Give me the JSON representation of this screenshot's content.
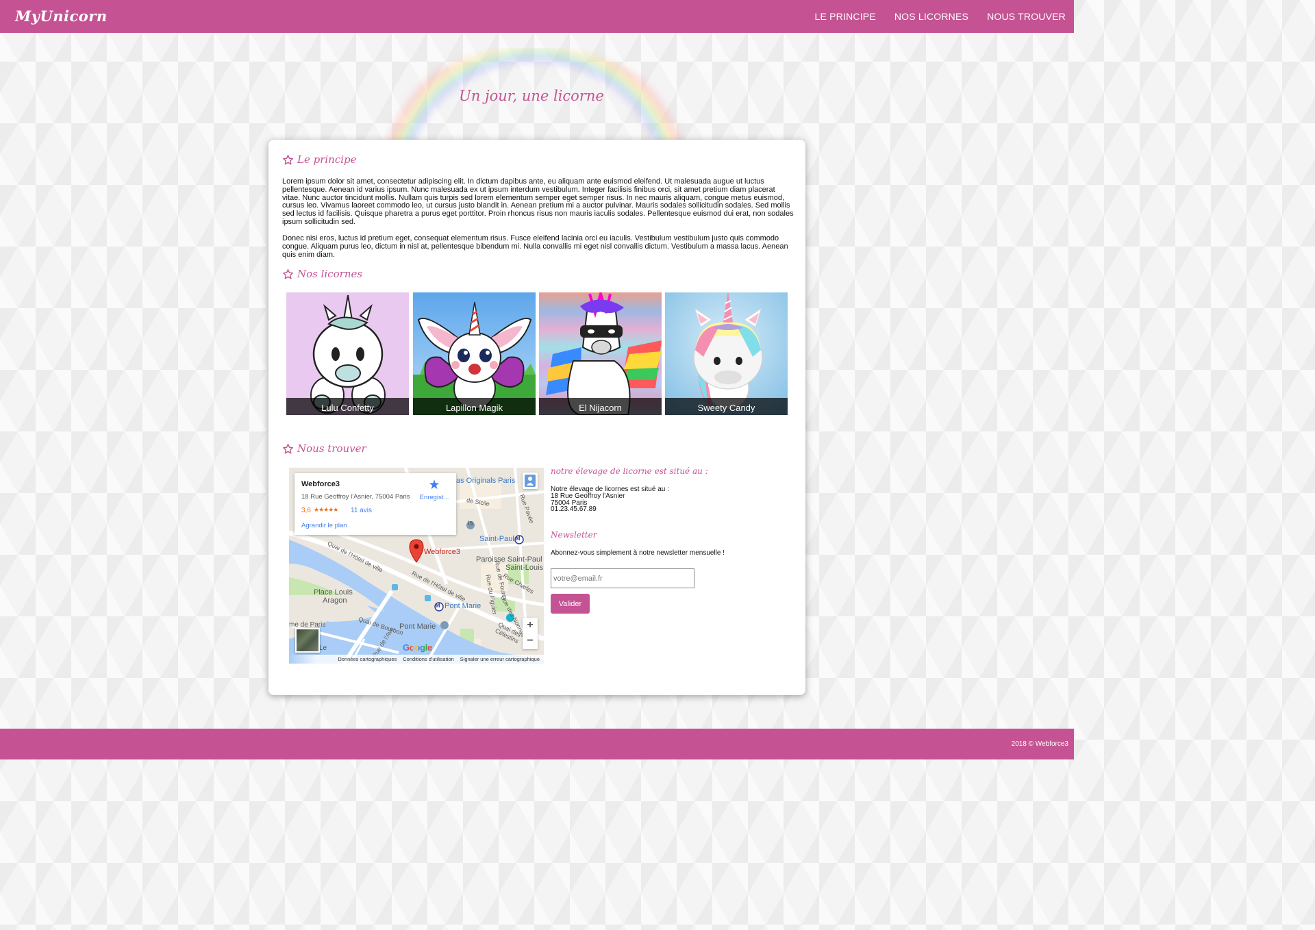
{
  "navbar": {
    "brand": "MyUnicorn",
    "links": [
      "LE PRINCIPE",
      "NOS LICORNES",
      "NOUS TROUVER"
    ]
  },
  "hero": {
    "title": "Un jour, une licorne"
  },
  "principe": {
    "title": "Le principe",
    "paragraphs": [
      "Lorem ipsum dolor sit amet, consectetur adipiscing elit. In dictum dapibus ante, eu aliquam ante euismod eleifend. Ut malesuada augue ut luctus pellentesque. Aenean id varius ipsum. Nunc malesuada ex ut ipsum interdum vestibulum. Integer facilisis finibus orci, sit amet pretium diam placerat vitae. Nunc auctor tincidunt mollis. Nullam quis turpis sed lorem elementum semper eget semper risus. In nec mauris aliquam, congue metus euismod, cursus leo. Vivamus laoreet commodo leo, ut cursus justo blandit in. Aenean pretium mi a auctor pulvinar. Mauris sodales sollicitudin sodales. Sed mollis sed lectus id facilisis. Quisque pharetra a purus eget porttitor. Proin rhoncus risus non mauris iaculis sodales. Pellentesque euismod dui erat, non sodales ipsum sollicitudin sed.",
      "Donec nisi eros, luctus id pretium eget, consequat elementum risus. Fusce eleifend lacinia orci eu iaculis. Vestibulum vestibulum justo quis commodo congue. Aliquam purus leo, dictum in nisl at, pellentesque bibendum mi. Nulla convallis mi eget nisl convallis dictum. Vestibulum a massa lacus. Aenean quis enim diam."
    ]
  },
  "licornes": {
    "title": "Nos licornes",
    "items": [
      {
        "name": "Lulu Confetty",
        "bg": "#e9c9ef"
      },
      {
        "name": "Lapillon Magik",
        "bg": "#8cc4f0"
      },
      {
        "name": "El Nijacorn",
        "bg": "#c8b6d8"
      },
      {
        "name": "Sweety Candy",
        "bg": "#a9d3ec"
      }
    ]
  },
  "trouver": {
    "title": "Nous trouver",
    "map": {
      "place_name": "Webforce3",
      "address": "18 Rue Geoffroy l'Asnier, 75004 Paris",
      "rating": "3,6",
      "stars": "★★★★★",
      "reviews": "11 avis",
      "save_label": "Enregist...",
      "enlarge_label": "Agrandir le plan",
      "marker_label": "Webforce3",
      "labels": {
        "originals": "as Originals Paris",
        "saint_paul": "Saint-Paul",
        "paroisse": "Paroisse Saint-Paul",
        "saint_louis": "Saint-Louis",
        "place_louis": "Place Louis",
        "aragon": "Aragon",
        "pont_marie_metro": "Pont Marie",
        "pont_marie": "Pont Marie",
        "de_paris": "me de Paris",
        "quai_hotel": "Quai de l'Hôtel de ville",
        "rue_hotel": "Rue de l'Hôtel de ville",
        "quai_bourbon": "Quai de Bourbon",
        "quai_celestins": "Quai des Célestins",
        "rue_charles": "Rue Charles",
        "rue_pavee": "Rue Pavée",
        "rue_sicile": "de Sicile",
        "rue_figuier": "Rue du Figuier",
        "rue_nonnains": "Rue des Nonnains",
        "rue_fourcy": "Rue de Fourcy",
        "rue_ave": "Rue de l'Ave",
        "is": "is",
        "le": "Le",
        "m": "M"
      },
      "google": "Google",
      "footer": [
        "Données cartographiques",
        "Conditions d'utilisation",
        "Signaler une erreur cartographique"
      ],
      "zoom_in": "+",
      "zoom_out": "−"
    },
    "address_title": "notre élevage de licorne est situé au :",
    "address_lines": [
      "Notre élevage de licornes est situé au :",
      "18 Rue Geoffroy l'Asnier",
      "75004 Paris",
      "01.23.45.67.89"
    ],
    "newsletter_title": "Newsletter",
    "newsletter_text": "Abonnez-vous simplement à notre newsletter mensuelle !",
    "email_placeholder": "votre@email.fr",
    "submit_label": "Valider"
  },
  "footer": {
    "text": "2018 © Webforce3"
  },
  "colors": {
    "brand": "#c55393"
  }
}
